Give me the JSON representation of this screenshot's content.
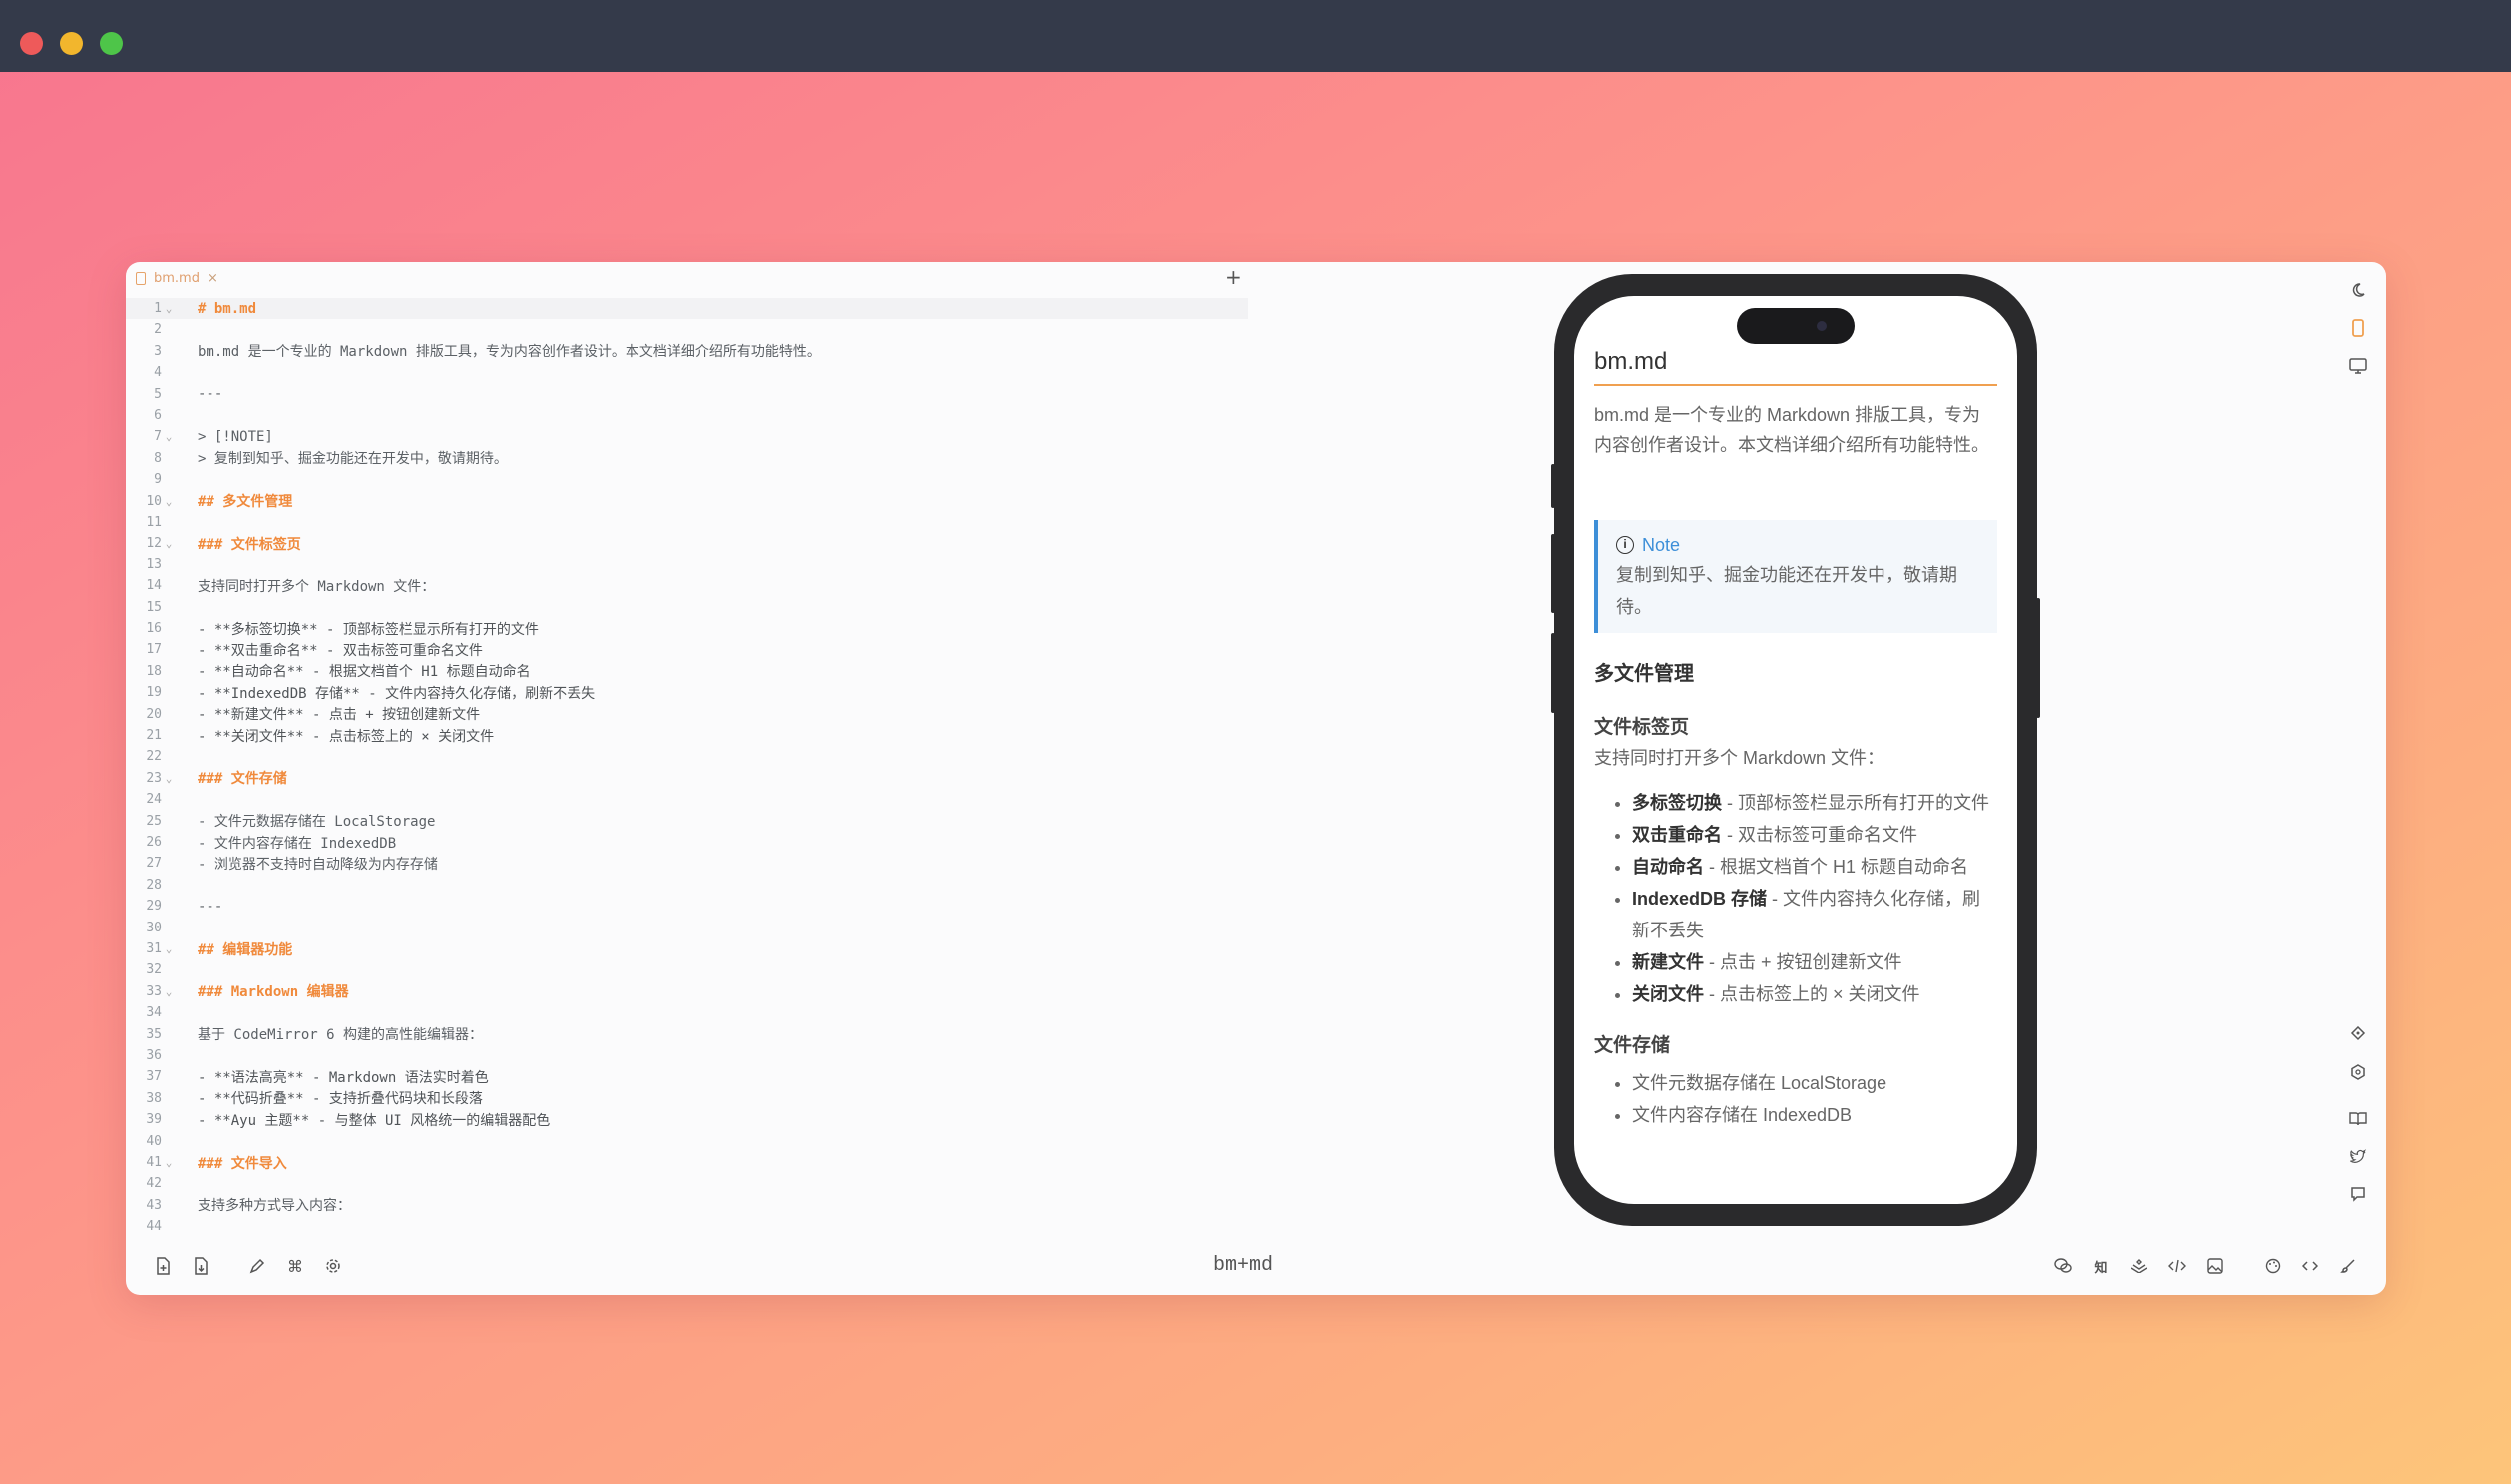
{
  "window": {
    "title": ""
  },
  "tab": {
    "label": "bm.md",
    "close": "×",
    "add": "+"
  },
  "editor": {
    "lines": [
      {
        "n": "1",
        "fold": "⌄",
        "text": "# bm.md",
        "cls": "h",
        "active": true
      },
      {
        "n": "2",
        "text": ""
      },
      {
        "n": "3",
        "text": "bm.md 是一个专业的 Markdown 排版工具，专为内容创作者设计。本文档详细介绍所有功能特性。"
      },
      {
        "n": "4",
        "text": ""
      },
      {
        "n": "5",
        "text": "---"
      },
      {
        "n": "6",
        "text": ""
      },
      {
        "n": "7",
        "fold": "⌄",
        "text": "> [!NOTE]",
        "cls": "note"
      },
      {
        "n": "8",
        "text": "> 复制到知乎、掘金功能还在开发中，敬请期待。"
      },
      {
        "n": "9",
        "text": ""
      },
      {
        "n": "10",
        "fold": "⌄",
        "text": "## 多文件管理",
        "cls": "h"
      },
      {
        "n": "11",
        "text": ""
      },
      {
        "n": "12",
        "fold": "⌄",
        "text": "### 文件标签页",
        "cls": "h"
      },
      {
        "n": "13",
        "text": ""
      },
      {
        "n": "14",
        "text": "支持同时打开多个 Markdown 文件："
      },
      {
        "n": "15",
        "text": ""
      },
      {
        "n": "16",
        "text": "- **多标签切换** - 顶部标签栏显示所有打开的文件",
        "cls": "bold"
      },
      {
        "n": "17",
        "text": "- **双击重命名** - 双击标签可重命名文件",
        "cls": "bold"
      },
      {
        "n": "18",
        "text": "- **自动命名** - 根据文档首个 H1 标题自动命名",
        "cls": "bold"
      },
      {
        "n": "19",
        "text": "- **IndexedDB 存储** - 文件内容持久化存储，刷新不丢失",
        "cls": "bold"
      },
      {
        "n": "20",
        "text": "- **新建文件** - 点击 + 按钮创建新文件",
        "cls": "bold"
      },
      {
        "n": "21",
        "text": "- **关闭文件** - 点击标签上的 × 关闭文件",
        "cls": "bold"
      },
      {
        "n": "22",
        "text": ""
      },
      {
        "n": "23",
        "fold": "⌄",
        "text": "### 文件存储",
        "cls": "h"
      },
      {
        "n": "24",
        "text": ""
      },
      {
        "n": "25",
        "text": "- 文件元数据存储在 LocalStorage"
      },
      {
        "n": "26",
        "text": "- 文件内容存储在 IndexedDB"
      },
      {
        "n": "27",
        "text": "- 浏览器不支持时自动降级为内存存储"
      },
      {
        "n": "28",
        "text": ""
      },
      {
        "n": "29",
        "text": "---"
      },
      {
        "n": "30",
        "text": ""
      },
      {
        "n": "31",
        "fold": "⌄",
        "text": "## 编辑器功能",
        "cls": "h"
      },
      {
        "n": "32",
        "text": ""
      },
      {
        "n": "33",
        "fold": "⌄",
        "text": "### Markdown 编辑器",
        "cls": "h"
      },
      {
        "n": "34",
        "text": ""
      },
      {
        "n": "35",
        "text": "基于 CodeMirror 6 构建的高性能编辑器："
      },
      {
        "n": "36",
        "text": ""
      },
      {
        "n": "37",
        "text": "- **语法高亮** - Markdown 语法实时着色",
        "cls": "bold"
      },
      {
        "n": "38",
        "text": "- **代码折叠** - 支持折叠代码块和长段落",
        "cls": "bold"
      },
      {
        "n": "39",
        "text": "- **Ayu 主题** - 与整体 UI 风格统一的编辑器配色",
        "cls": "bold"
      },
      {
        "n": "40",
        "text": ""
      },
      {
        "n": "41",
        "fold": "⌄",
        "text": "### 文件导入",
        "cls": "h"
      },
      {
        "n": "42",
        "text": ""
      },
      {
        "n": "43",
        "text": "支持多种方式导入内容："
      },
      {
        "n": "44",
        "text": ""
      }
    ]
  },
  "preview": {
    "title": "bm.md",
    "intro": "bm.md 是一个专业的 Markdown 排版工具，专为内容创作者设计。本文档详细介绍所有功能特性。",
    "note_label": "Note",
    "note_body": "复制到知乎、掘金功能还在开发中，敬请期待。",
    "h2": "多文件管理",
    "h3_tabs": "文件标签页",
    "tabs_intro": "支持同时打开多个 Markdown 文件：",
    "tab_items": [
      {
        "bold": "多标签切换",
        "text": " - 顶部标签栏显示所有打开的文件"
      },
      {
        "bold": "双击重命名",
        "text": " - 双击标签可重命名文件"
      },
      {
        "bold": "自动命名",
        "text": " - 根据文档首个 H1 标题自动命名"
      },
      {
        "bold": "IndexedDB 存储",
        "text": " - 文件内容持久化存储，刷新不丢失"
      },
      {
        "bold": "新建文件",
        "text": " - 点击 + 按钮创建新文件"
      },
      {
        "bold": "关闭文件",
        "text": " - 点击标签上的 × 关闭文件"
      }
    ],
    "h3_storage": "文件存储",
    "storage_items": [
      "文件元数据存储在 LocalStorage",
      "文件内容存储在 IndexedDB"
    ]
  },
  "bottombar": {
    "brand": "bm+md"
  },
  "icons": {
    "right": [
      "moon-icon",
      "phone-icon",
      "monitor-icon",
      "share-icon",
      "hexagon-icon",
      "book-icon",
      "twitter-icon",
      "message-icon"
    ],
    "bottom_left": [
      "new-file-icon",
      "import-file-icon",
      "pen-icon",
      "command-icon",
      "settings-icon"
    ],
    "bottom_right": [
      "wechat-icon",
      "zhihu-icon",
      "juejin-icon",
      "code-copy-icon",
      "image-export-icon",
      "palette-icon",
      "code-icon",
      "brush-icon"
    ]
  },
  "colors": {
    "accent": "#f0a050",
    "note": "#3d8fd8"
  }
}
